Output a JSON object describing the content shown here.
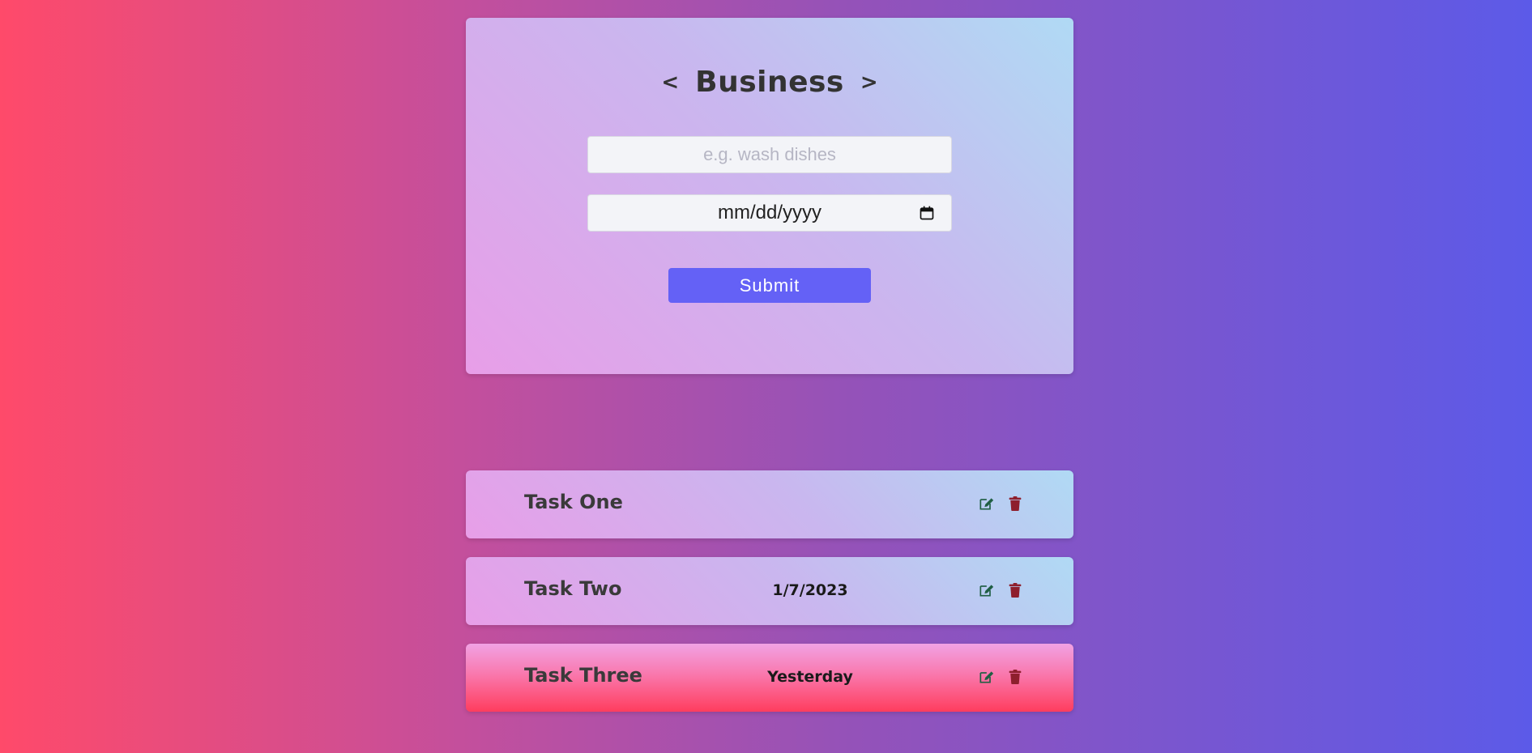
{
  "category": {
    "prev_icon": "chevron-left-icon",
    "title": "Business",
    "next_icon": "chevron-right-icon"
  },
  "form": {
    "task_placeholder": "e.g. wash dishes",
    "date_placeholder": "mm/dd/yyyy",
    "submit_label": "Submit"
  },
  "tasks": [
    {
      "title": "Task One",
      "date": ""
    },
    {
      "title": "Task Two",
      "date": "1/7/2023"
    },
    {
      "title": "Task Three",
      "date": "Yesterday"
    }
  ],
  "icons": {
    "edit": "edit-icon",
    "delete": "trash-icon",
    "calendar": "calendar-icon"
  },
  "colors": {
    "accent": "#6461F6",
    "edit_icon": "#1F5E43",
    "delete_icon": "#8E1F2D"
  }
}
